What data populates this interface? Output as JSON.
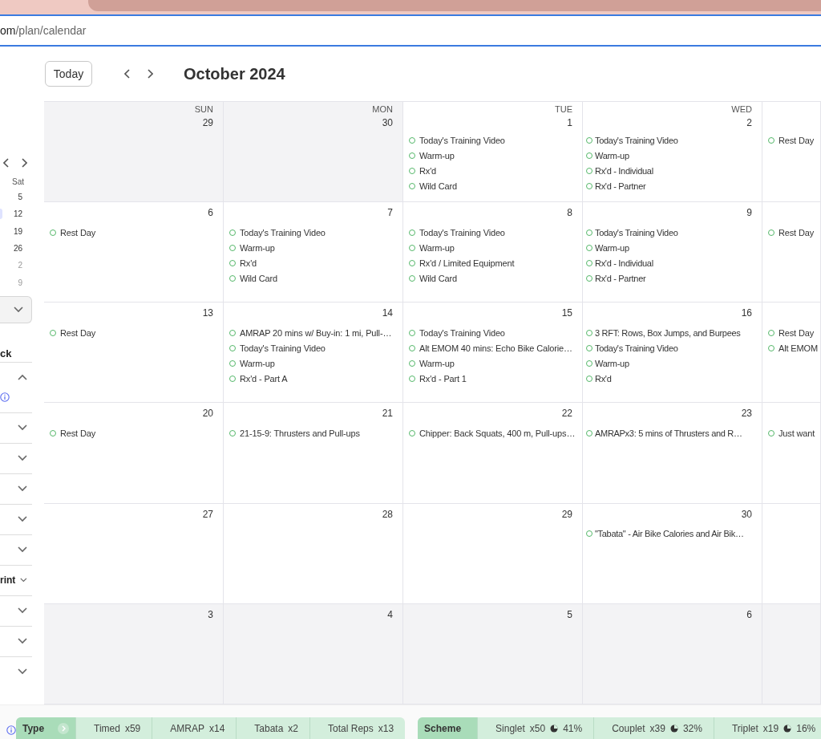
{
  "browser": {
    "url_host": "om",
    "url_path": "/plan/calendar"
  },
  "sidebar": {
    "mini_calendar": {
      "weekday": "Sat",
      "days": [
        {
          "label": "5",
          "outside": false,
          "selected": false
        },
        {
          "label": "12",
          "outside": false,
          "selected": true
        },
        {
          "label": "19",
          "outside": false,
          "selected": false
        },
        {
          "label": "26",
          "outside": false,
          "selected": false
        },
        {
          "label": "2",
          "outside": true,
          "selected": false
        },
        {
          "label": "9",
          "outside": true,
          "selected": false
        }
      ]
    },
    "section_title": "ck",
    "accordions": [
      {
        "expanded": true
      },
      {
        "expanded": false
      },
      {
        "expanded": false
      },
      {
        "expanded": false
      },
      {
        "expanded": false
      },
      {
        "expanded": false
      },
      {
        "label": "rint",
        "expanded": false
      },
      {
        "expanded": false
      },
      {
        "expanded": false
      },
      {
        "expanded": false
      }
    ]
  },
  "calendar": {
    "toolbar": {
      "today": "Today",
      "title": "October 2024"
    },
    "weekdays": [
      "SUN",
      "MON",
      "TUE",
      "WED"
    ],
    "weeks": [
      {
        "days": [
          {
            "date": "29",
            "outside": true
          },
          {
            "date": "30",
            "outside": true
          },
          {
            "date": "1",
            "outside": false,
            "events": [
              "Today's Training Video",
              "Warm-up",
              "Rx'd",
              "Wild Card"
            ]
          },
          {
            "date": "2",
            "outside": false,
            "events": [
              "Today's Training Video",
              "Warm-up",
              "Rx'd - Individual",
              "Rx'd - Partner"
            ]
          },
          {
            "outside": false,
            "events": [
              "Rest Day"
            ]
          }
        ]
      },
      {
        "days": [
          {
            "date": "6",
            "outside": false,
            "events": [
              "Rest Day"
            ]
          },
          {
            "date": "7",
            "outside": false,
            "events": [
              "Today's Training Video",
              "Warm-up",
              "Rx'd",
              "Wild Card"
            ]
          },
          {
            "date": "8",
            "outside": false,
            "events": [
              "Today's Training Video",
              "Warm-up",
              "Rx'd / Limited Equipment",
              "Wild Card"
            ]
          },
          {
            "date": "9",
            "outside": false,
            "events": [
              "Today's Training Video",
              "Warm-up",
              "Rx'd - Individual",
              "Rx'd - Partner"
            ]
          },
          {
            "outside": false,
            "events": [
              "Rest Day"
            ]
          }
        ]
      },
      {
        "days": [
          {
            "date": "13",
            "outside": false,
            "events": [
              "Rest Day"
            ]
          },
          {
            "date": "14",
            "outside": false,
            "events": [
              "AMRAP 20 mins w/ Buy-in: 1 mi, Pull-…",
              "Today's Training Video",
              "Warm-up",
              "Rx'd - Part A"
            ]
          },
          {
            "date": "15",
            "outside": false,
            "events": [
              "Today's Training Video",
              "Alt EMOM 40 mins: Echo Bike Calorie…",
              "Warm-up",
              "Rx'd - Part 1"
            ]
          },
          {
            "date": "16",
            "outside": false,
            "events": [
              "3 RFT: Rows, Box Jumps, and Burpees",
              "Today's Training Video",
              "Warm-up",
              "Rx'd"
            ]
          },
          {
            "outside": false,
            "events": [
              "Rest Day",
              "Alt EMOM"
            ]
          }
        ]
      },
      {
        "days": [
          {
            "date": "20",
            "outside": false,
            "events": [
              "Rest Day"
            ]
          },
          {
            "date": "21",
            "outside": false,
            "events": [
              "21-15-9: Thrusters and Pull-ups"
            ]
          },
          {
            "date": "22",
            "outside": false,
            "events": [
              "Chipper: Back Squats, 400 m, Pull-ups…"
            ]
          },
          {
            "date": "23",
            "outside": false,
            "events": [
              "AMRAPx3: 5 mins of Thrusters and R…"
            ]
          },
          {
            "outside": false,
            "events": [
              "Just want"
            ]
          }
        ]
      },
      {
        "days": [
          {
            "date": "27",
            "outside": false
          },
          {
            "date": "28",
            "outside": false
          },
          {
            "date": "29",
            "outside": false
          },
          {
            "date": "30",
            "outside": false,
            "events": [
              "\"Tabata\" - Air Bike Calories and Air Bik…"
            ]
          },
          {
            "outside": false
          }
        ]
      },
      {
        "days": [
          {
            "date": "3",
            "outside": true
          },
          {
            "date": "4",
            "outside": true
          },
          {
            "date": "5",
            "outside": true
          },
          {
            "date": "6",
            "outside": true
          },
          {
            "outside": true
          }
        ]
      }
    ]
  },
  "stats": [
    {
      "label": "Type",
      "items": [
        {
          "label": "Timed",
          "count": "x59"
        },
        {
          "label": "AMRAP",
          "count": "x14"
        },
        {
          "label": "Tabata",
          "count": "x2"
        },
        {
          "label": "Total Reps",
          "count": "x13"
        }
      ]
    },
    {
      "label": "Scheme",
      "items": [
        {
          "label": "Singlet",
          "count": "x50",
          "percent": "41%"
        },
        {
          "label": "Couplet",
          "count": "x39",
          "percent": "32%"
        },
        {
          "label": "Triplet",
          "count": "x19",
          "percent": "16%"
        }
      ]
    }
  ]
}
